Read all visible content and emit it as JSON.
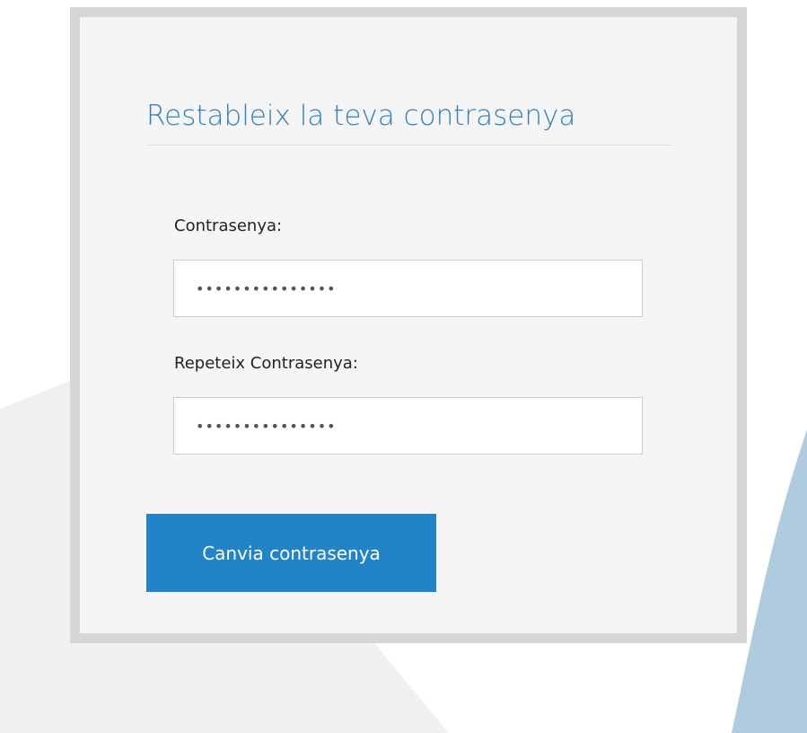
{
  "form": {
    "title": "Restableix la teva contrasenya",
    "password_label": "Contrasenya:",
    "password_value": "•••••••••••••••",
    "repeat_label": "Repeteix Contrasenya:",
    "repeat_value": "•••••••••••••••",
    "submit_label": "Canvia contrasenya"
  },
  "colors": {
    "title": "#2f80c0",
    "button": "#2383c8",
    "card_background": "#f5f5f5",
    "card_border": "#d6d6d6",
    "background_shape_left": "#eff0f0",
    "background_shape_right": "#aecbdf"
  }
}
